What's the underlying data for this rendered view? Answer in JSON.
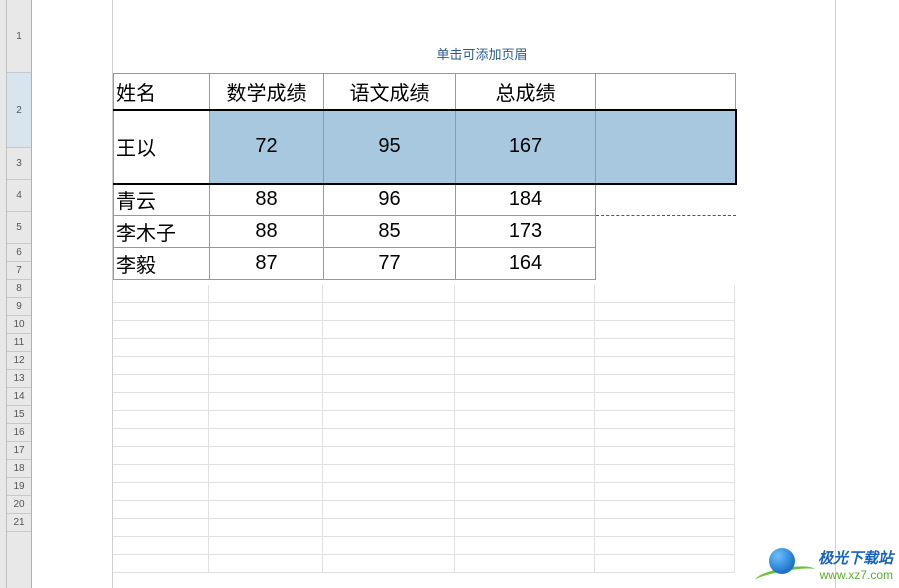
{
  "page": {
    "header_hint": "单击可添加页眉"
  },
  "table": {
    "headers": {
      "name": "姓名",
      "math": "数学成绩",
      "chinese": "语文成绩",
      "total": "总成绩"
    },
    "rows": [
      {
        "name": "王以",
        "math": "72",
        "chinese": "95",
        "total": "167"
      },
      {
        "name": "青云",
        "math": "88",
        "chinese": "96",
        "total": "184"
      },
      {
        "name": "李木子",
        "math": "88",
        "chinese": "85",
        "total": "173"
      },
      {
        "name": "李毅",
        "math": "87",
        "chinese": "77",
        "total": "164"
      }
    ]
  },
  "row_numbers": [
    "1",
    "2",
    "3",
    "4",
    "5",
    "6",
    "7",
    "8",
    "9",
    "10",
    "11",
    "12",
    "13",
    "14",
    "15",
    "16",
    "17",
    "18",
    "19",
    "20",
    "21"
  ],
  "watermark": {
    "title": "极光下载站",
    "url": "www.xz7.com"
  },
  "colors": {
    "highlight": "#a8c8df",
    "hint_text": "#2a5a8a"
  },
  "chart_data": {
    "type": "table",
    "title": "",
    "columns": [
      "姓名",
      "数学成绩",
      "语文成绩",
      "总成绩"
    ],
    "rows": [
      [
        "王以",
        72,
        95,
        167
      ],
      [
        "青云",
        88,
        96,
        184
      ],
      [
        "李木子",
        88,
        85,
        173
      ],
      [
        "李毅",
        87,
        77,
        164
      ]
    ]
  }
}
